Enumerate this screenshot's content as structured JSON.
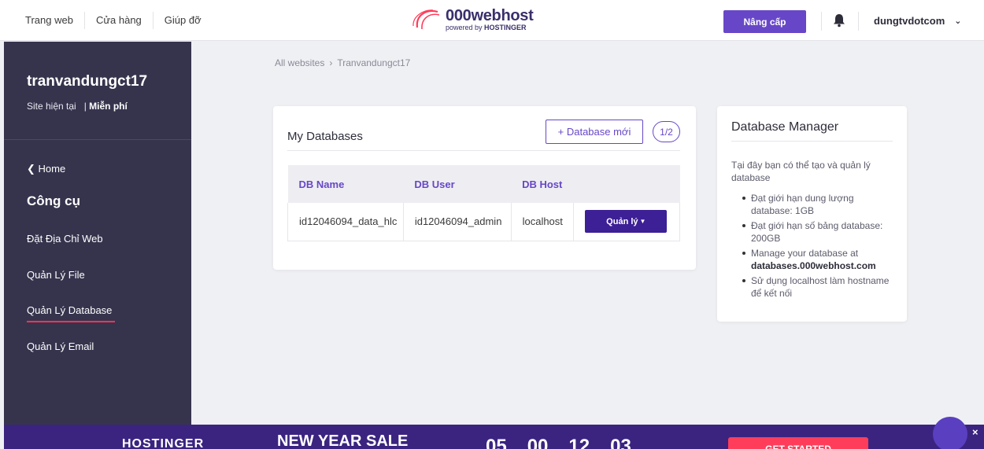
{
  "topnav": {
    "links": [
      "Trang web",
      "Cửa hàng",
      "Giúp đỡ"
    ],
    "logo_main": "000webhost",
    "logo_sub_prefix": "powered by ",
    "logo_sub_brand": "HOSTINGER",
    "upgrade_label": "Nâng cấp",
    "user_name": "dungtvdotcom"
  },
  "sidebar": {
    "site_name": "tranvandungct17",
    "site_status": "Site hiện tại",
    "site_plan": "Miễn phí",
    "home_label": "Home",
    "tools_title": "Công cụ",
    "items": [
      "Đặt Địa Chỉ Web",
      "Quản Lý File",
      "Quản Lý Database",
      "Quản Lý Email"
    ],
    "active_item": "Quản Lý Database"
  },
  "breadcrumb": {
    "root": "All websites",
    "current": "Tranvandungct17"
  },
  "databases": {
    "title": "My Databases",
    "new_button": "+ Database mới",
    "count": "1/2",
    "columns": [
      "DB Name",
      "DB User",
      "DB Host"
    ],
    "rows": [
      {
        "name": "id12046094_data_hlc",
        "user": "id12046094_admin",
        "host": "localhost",
        "action": "Quản lý"
      }
    ]
  },
  "manager": {
    "title": "Database Manager",
    "description": "Tại đây bạn có thể tạo và quản lý database",
    "items": [
      "Đạt giới hạn dung lượng database: 1GB",
      "Đạt giới hạn số bảng database: 200GB",
      "Manage your database at",
      "Sử dụng localhost làm hostname để kết nối"
    ],
    "link_text": "databases.000webhost.com"
  },
  "banner": {
    "brand": "HOSTINGER",
    "sale_text": "NEW YEAR SALE",
    "countdown": [
      "05",
      "00",
      "12",
      "03"
    ],
    "cta": "GET STARTED",
    "close": "×"
  },
  "colors": {
    "accent": "#6747c7",
    "sidebar_bg": "#36344d",
    "active_underline": "#ff3355",
    "banner_bg": "#3b2480",
    "cta_bg": "#ff3d5a"
  }
}
